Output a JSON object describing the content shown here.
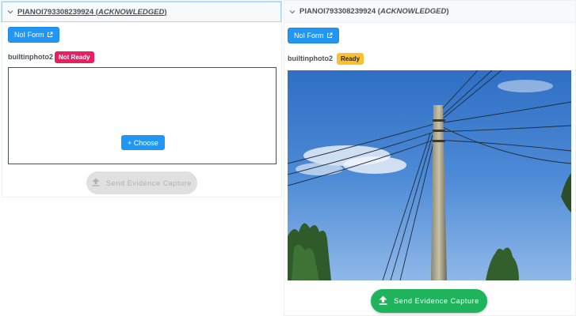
{
  "left_panel": {
    "header": {
      "id_text": "PIANOI793308239924",
      "status_text": "ACKNOWLEDGED"
    },
    "form_button_label": "NoI Form",
    "photo_label": "builtinphoto2",
    "badge_label": "Not Ready",
    "choose_label": "+ Choose",
    "send_label": "Send Evidence Capture"
  },
  "right_panel": {
    "header": {
      "id_text": "PIANOI793308239924",
      "status_text": "ACKNOWLEDGED"
    },
    "form_button_label": "NoI Form",
    "photo_label": "builtinphoto2",
    "badge_label": "Ready",
    "send_label": "Send Evidence Capture",
    "image": "photo of a utility pole with power lines against a blue sky"
  },
  "colors": {
    "primary": "#2196f3",
    "not_ready": "#e91e63",
    "ready": "#fbc02d",
    "send_enabled": "#1fb45b",
    "send_disabled": "#e0e0e0"
  }
}
